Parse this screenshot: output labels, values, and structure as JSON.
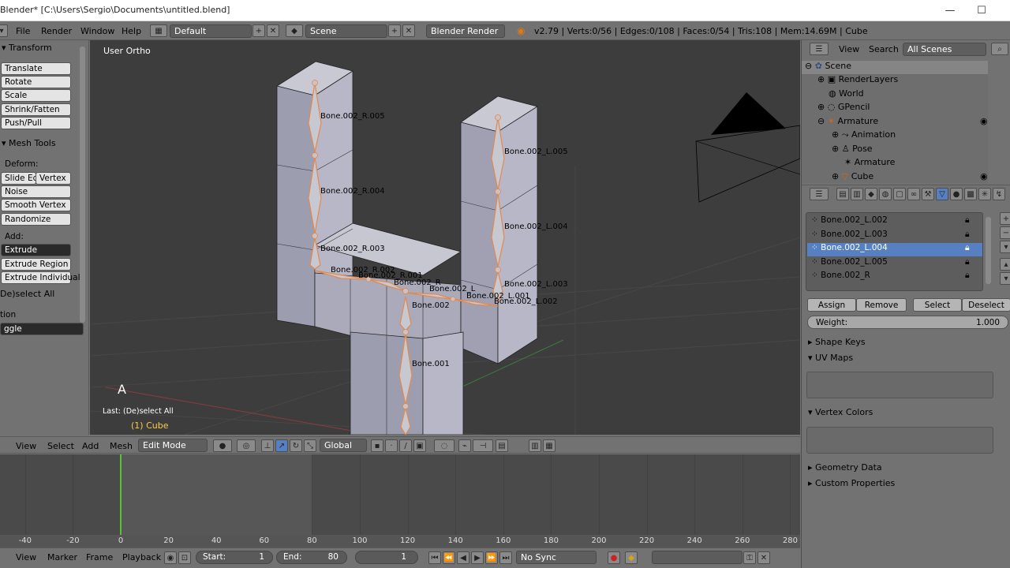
{
  "window": {
    "title": "Blender* [C:\\Users\\Sergio\\Documents\\untitled.blend]",
    "minimize": "—",
    "maximize": "☐"
  },
  "info_header": {
    "menus": [
      "File",
      "Render",
      "Window",
      "Help"
    ],
    "layout": "Default",
    "scene": "Scene",
    "engine": "Blender Render",
    "stats": "v2.79 | Verts:0/56 | Edges:0/108 | Faces:0/54 | Tris:108 | Mem:14.69M | Cube"
  },
  "toolshelf": {
    "transform_title": "Transform",
    "transform_buttons": [
      "Translate",
      "Rotate",
      "Scale",
      "Shrink/Fatten",
      "Push/Pull"
    ],
    "mesh_tools_title": "Mesh Tools",
    "deform_label": "Deform:",
    "slide_edge": "Slide Ed",
    "vertex": "Vertex",
    "deform_buttons": [
      "Noise",
      "Smooth Vertex",
      "Randomize"
    ],
    "add_label": "Add:",
    "extrude": "Extrude",
    "add_buttons": [
      "Extrude Region",
      "Extrude Individual"
    ],
    "last_op_title": "De)select All",
    "action_label": "tion",
    "action_value": "ggle"
  },
  "viewport": {
    "view_name": "User Ortho",
    "key_overlay": "A",
    "last_op": "Last: (De)select All",
    "object_info": "(1) Cube",
    "bone_labels": [
      "Bone.002_R.005",
      "Bone.002_R.004",
      "Bone.002_R.003",
      "Bone.002_R.002",
      "Bone.002_R.001",
      "Bone.002_R",
      "Bone.002",
      "Bone.001",
      "Bone.002_L",
      "Bone.002_L.001",
      "Bone.002_L.002",
      "Bone.002_L.003",
      "Bone.002_L.004",
      "Bone.002_L.005"
    ]
  },
  "view3d_header": {
    "menus": [
      "View",
      "Select",
      "Add",
      "Mesh"
    ],
    "mode": "Edit Mode",
    "orientation": "Global"
  },
  "timeline": {
    "ticks": [
      "-40",
      "-20",
      "0",
      "20",
      "40",
      "60",
      "80",
      "100",
      "120",
      "140",
      "160",
      "180",
      "200",
      "220",
      "240",
      "260",
      "280"
    ],
    "menus": [
      "View",
      "Marker",
      "Frame",
      "Playback"
    ],
    "start_label": "Start:",
    "start_value": "1",
    "end_label": "End:",
    "end_value": "80",
    "current_frame": "1",
    "sync": "No Sync"
  },
  "outliner": {
    "view": "View",
    "search": "Search",
    "filter": "All Scenes",
    "rows": [
      {
        "label": "Scene"
      },
      {
        "label": "RenderLayers"
      },
      {
        "label": "World"
      },
      {
        "label": "GPencil"
      },
      {
        "label": "Armature"
      },
      {
        "label": "Animation"
      },
      {
        "label": "Pose"
      },
      {
        "label": "Armature"
      },
      {
        "label": "Cube"
      }
    ]
  },
  "properties": {
    "vertex_groups": [
      "Bone.002_L.002",
      "Bone.002_L.003",
      "Bone.002_L.004",
      "Bone.002_L.005",
      "Bone.002_R"
    ],
    "selected_group": "Bone.002_L.004",
    "assign": "Assign",
    "remove": "Remove",
    "select": "Select",
    "deselect": "Deselect",
    "weight_label": "Weight:",
    "weight_value": "1.000",
    "shape_keys": "Shape Keys",
    "uv_maps": "UV Maps",
    "vertex_colors": "Vertex Colors",
    "geometry_data": "Geometry Data",
    "custom_properties": "Custom Properties"
  },
  "colors": {
    "selection_blue": "#5680c2",
    "timeline_cursor": "#55c435",
    "bone_orange": "#e08a50",
    "mesh_face": "#b9b9c6"
  }
}
